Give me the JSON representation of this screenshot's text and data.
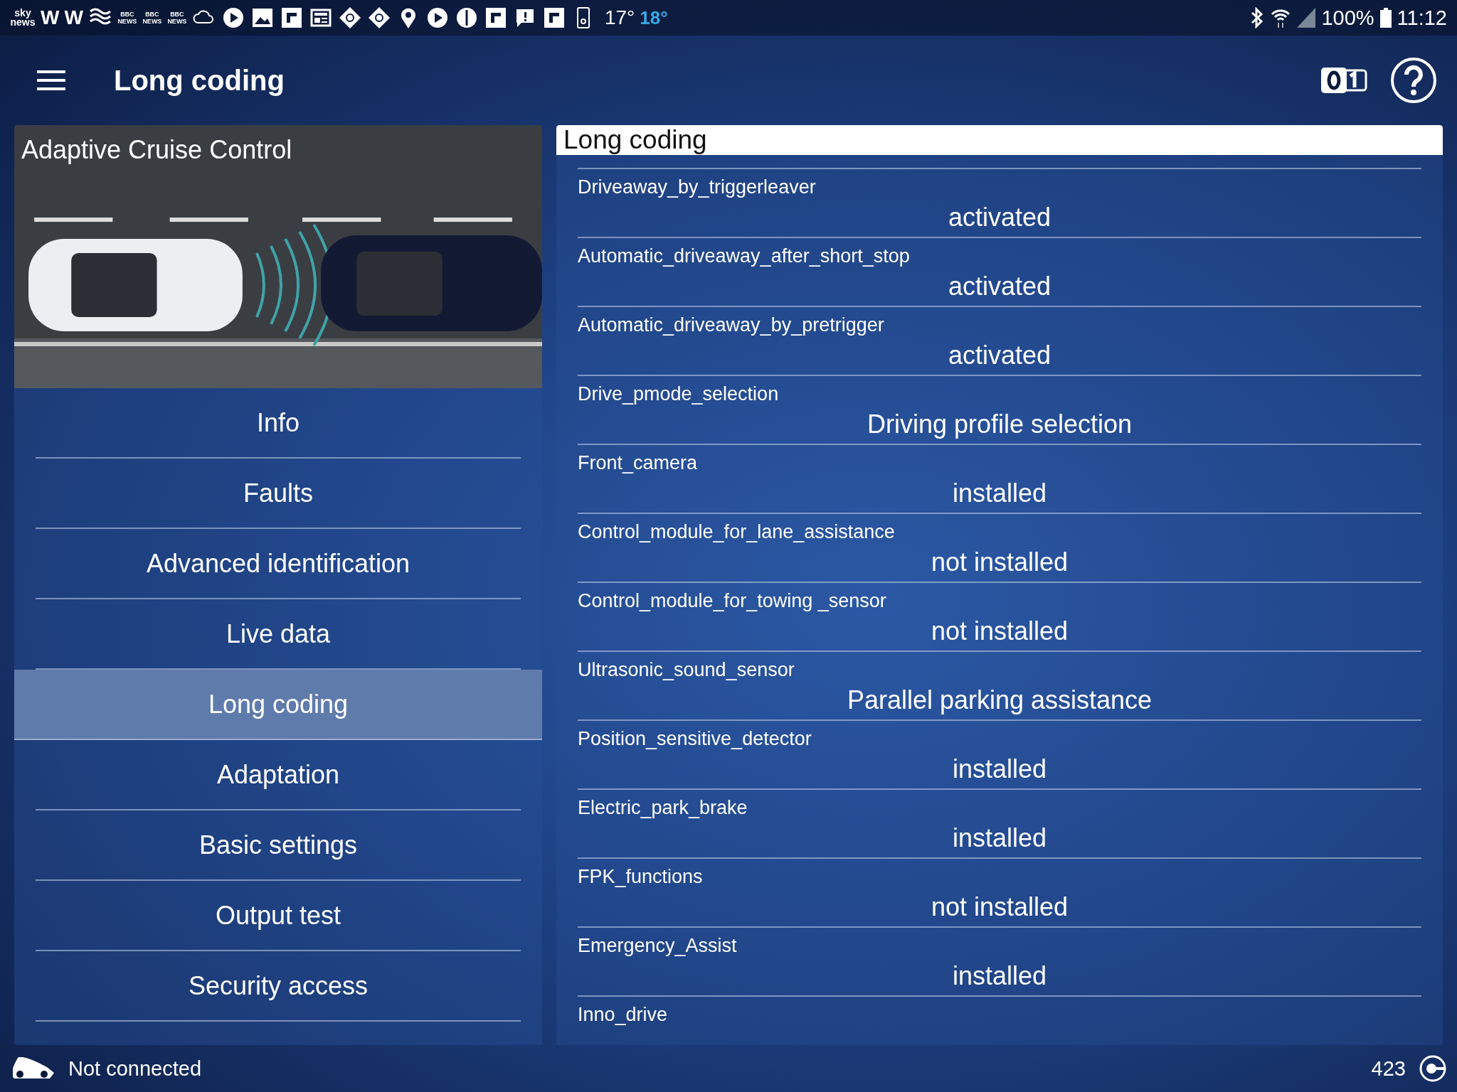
{
  "status_bar": {
    "notifications": [
      {
        "kind": "logo",
        "text": "sky news"
      },
      {
        "kind": "letter",
        "text": "W"
      },
      {
        "kind": "letter",
        "text": "W"
      },
      {
        "kind": "waves"
      },
      {
        "kind": "bbc",
        "text": "BBC NEWS"
      },
      {
        "kind": "bbc",
        "text": "BBC NEWS"
      },
      {
        "kind": "bbc",
        "text": "BBC NEWS"
      },
      {
        "kind": "cloud"
      },
      {
        "kind": "play"
      },
      {
        "kind": "image"
      },
      {
        "kind": "flip"
      },
      {
        "kind": "newspaper"
      },
      {
        "kind": "diamond"
      },
      {
        "kind": "diamond"
      },
      {
        "kind": "pin"
      },
      {
        "kind": "play"
      },
      {
        "kind": "globe"
      },
      {
        "kind": "flip"
      },
      {
        "kind": "chat"
      },
      {
        "kind": "flip"
      },
      {
        "kind": "phone"
      }
    ],
    "temperature": "17°",
    "temperature_high": "18°",
    "battery": "100%",
    "time": "11:12"
  },
  "header": {
    "title": "Long coding"
  },
  "module": {
    "title": "Adaptive Cruise Control"
  },
  "menu": [
    {
      "label": "Info",
      "selected": false
    },
    {
      "label": "Faults",
      "selected": false
    },
    {
      "label": "Advanced identification",
      "selected": false
    },
    {
      "label": "Live data",
      "selected": false
    },
    {
      "label": "Long coding",
      "selected": true
    },
    {
      "label": "Adaptation",
      "selected": false
    },
    {
      "label": "Basic settings",
      "selected": false
    },
    {
      "label": "Output test",
      "selected": false
    },
    {
      "label": "Security access",
      "selected": false
    }
  ],
  "coding": {
    "title": "Long coding",
    "rows": [
      {
        "name": "Driveaway_by_triggerleaver",
        "value": "activated"
      },
      {
        "name": "Automatic_driveaway_after_short_stop",
        "value": "activated"
      },
      {
        "name": "Automatic_driveaway_by_pretrigger",
        "value": "activated"
      },
      {
        "name": "Drive_pmode_selection",
        "value": "Driving profile selection"
      },
      {
        "name": "Front_camera",
        "value": "installed"
      },
      {
        "name": "Control_module_for_lane_assistance",
        "value": "not installed"
      },
      {
        "name": "Control_module_for_towing _sensor",
        "value": "not installed"
      },
      {
        "name": "Ultrasonic_sound_sensor",
        "value": "Parallel parking assistance"
      },
      {
        "name": "Position_sensitive_detector",
        "value": "installed"
      },
      {
        "name": "Electric_park_brake",
        "value": "installed"
      },
      {
        "name": "FPK_functions",
        "value": "not installed"
      },
      {
        "name": "Emergency_Assist",
        "value": "installed"
      },
      {
        "name": "Inno_drive"
      }
    ]
  },
  "footer": {
    "connection": "Not connected",
    "count": "423"
  }
}
